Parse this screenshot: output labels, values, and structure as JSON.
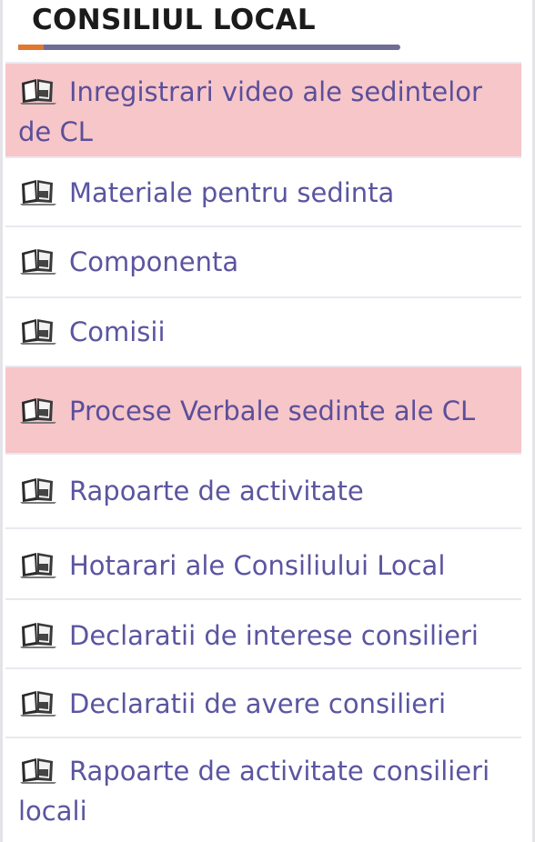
{
  "header": {
    "title": "CONSILIUL LOCAL"
  },
  "menu": {
    "items": [
      {
        "label": "Inregistrari video ale sedintelor de CL",
        "highlighted": true,
        "icon": "book-icon"
      },
      {
        "label": "Materiale pentru sedinta",
        "highlighted": false,
        "icon": "book-icon"
      },
      {
        "label": "Componenta",
        "highlighted": false,
        "icon": "book-icon"
      },
      {
        "label": "Comisii",
        "highlighted": false,
        "icon": "book-icon"
      },
      {
        "label": "Procese Verbale sedinte ale CL",
        "highlighted": true,
        "icon": "book-icon"
      },
      {
        "label": "Rapoarte de activitate",
        "highlighted": false,
        "icon": "book-icon"
      },
      {
        "label": "Hotarari ale Consiliului Local",
        "highlighted": false,
        "icon": "book-icon"
      },
      {
        "label": "Declaratii de interese consilieri",
        "highlighted": false,
        "icon": "book-icon"
      },
      {
        "label": "Declaratii de avere consilieri",
        "highlighted": false,
        "icon": "book-icon"
      },
      {
        "label": "Rapoarte de activitate consilieri locali",
        "highlighted": false,
        "icon": "book-icon"
      }
    ]
  },
  "colors": {
    "link": "#5b55a0",
    "highlight": "#f7c6c9",
    "header_accent": "#e07830",
    "header_rule": "#6f6c96"
  }
}
